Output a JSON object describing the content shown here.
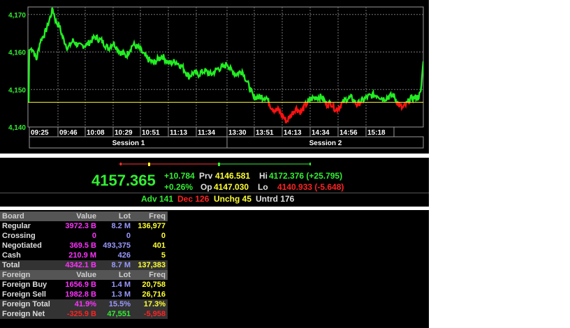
{
  "chart_data": {
    "type": "line",
    "x_ticks": [
      "09:25",
      "09:46",
      "10:08",
      "10:29",
      "10:51",
      "11:13",
      "11:34",
      "13:30",
      "13:51",
      "14:13",
      "14:34",
      "14:56",
      "15:18"
    ],
    "y_ticks": [
      "4,170",
      "4,160",
      "4,150",
      "4,140"
    ],
    "ylim": [
      4140,
      4172
    ],
    "reference_line": 4146.581,
    "sessions": [
      "Session 1",
      "Session 2"
    ],
    "grid": true,
    "colors": {
      "above": "#22ee22",
      "below": "#ff1111",
      "reference": "#ffff33"
    },
    "keypoints": [
      [
        0,
        4146.6
      ],
      [
        1,
        4160.5
      ],
      [
        6,
        4161
      ],
      [
        12,
        4158
      ],
      [
        18,
        4163
      ],
      [
        25,
        4165
      ],
      [
        31,
        4168
      ],
      [
        37,
        4171.5
      ],
      [
        42,
        4168
      ],
      [
        47,
        4167
      ],
      [
        52,
        4164
      ],
      [
        60,
        4161
      ],
      [
        68,
        4163
      ],
      [
        78,
        4161.5
      ],
      [
        90,
        4162
      ],
      [
        102,
        4164
      ],
      [
        112,
        4163
      ],
      [
        122,
        4161
      ],
      [
        130,
        4162.5
      ],
      [
        140,
        4160
      ],
      [
        150,
        4159
      ],
      [
        160,
        4162
      ],
      [
        170,
        4161
      ],
      [
        180,
        4158.5
      ],
      [
        192,
        4157
      ],
      [
        205,
        4159
      ],
      [
        215,
        4157
      ],
      [
        226,
        4157.5
      ],
      [
        236,
        4156
      ],
      [
        246,
        4153.5
      ],
      [
        253,
        4154.5
      ],
      [
        260,
        4154
      ],
      [
        270,
        4155
      ],
      [
        280,
        4154
      ],
      [
        290,
        4155.5
      ],
      [
        300,
        4156
      ],
      [
        305,
        4157
      ],
      [
        310,
        4155.3
      ],
      [
        318,
        4154
      ],
      [
        328,
        4155
      ],
      [
        338,
        4151
      ],
      [
        345,
        4148
      ],
      [
        355,
        4148
      ],
      [
        365,
        4148
      ],
      [
        372,
        4145.5
      ],
      [
        378,
        4144.5
      ],
      [
        384,
        4144.5
      ],
      [
        390,
        4143
      ],
      [
        396,
        4141.5
      ],
      [
        402,
        4143
      ],
      [
        410,
        4145
      ],
      [
        418,
        4144
      ],
      [
        426,
        4146
      ],
      [
        434,
        4147.5
      ],
      [
        442,
        4148
      ],
      [
        450,
        4148
      ],
      [
        458,
        4146
      ],
      [
        464,
        4146.5
      ],
      [
        472,
        4144.5
      ],
      [
        480,
        4146
      ],
      [
        488,
        4147.5
      ],
      [
        496,
        4147.8
      ],
      [
        504,
        4146
      ],
      [
        512,
        4147
      ],
      [
        520,
        4148
      ],
      [
        528,
        4148.5
      ],
      [
        536,
        4148.5
      ],
      [
        544,
        4147.5
      ],
      [
        552,
        4148
      ],
      [
        560,
        4148.5
      ],
      [
        568,
        4146
      ],
      [
        574,
        4145
      ],
      [
        580,
        4146
      ],
      [
        586,
        4147.5
      ],
      [
        592,
        4147.8
      ],
      [
        598,
        4148
      ],
      [
        602,
        4149
      ],
      [
        606,
        4157.5
      ]
    ]
  },
  "summary": {
    "index": "4157.365",
    "change": "+10.784",
    "change_pct": "+0.26%",
    "prv_label": "Prv",
    "prv": "4146.581",
    "op_label": "Op",
    "op": "4147.030",
    "hi_label": "Hi",
    "hi": "4172.376 (+25.795)",
    "lo_label": "Lo",
    "lo": "4140.933 (-5.648)"
  },
  "breadth": {
    "adv": "Adv 141",
    "dec": "Dec 126",
    "unchg": "Unchg 45",
    "untrd": "Untrd 176"
  },
  "board_table": {
    "header1": [
      "Board",
      "Value",
      "Lot",
      "Freq"
    ],
    "rows1": [
      [
        "Regular",
        "3972.3 B",
        "8.2 M",
        "136,977"
      ],
      [
        "Crossing",
        "0",
        "0",
        "0"
      ],
      [
        "Negotiated",
        "369.5 B",
        "493,375",
        "401"
      ],
      [
        "Cash",
        "210.9 M",
        "426",
        "5"
      ]
    ],
    "total": [
      "Total",
      "4342.1 B",
      "8.7 M",
      "137,383"
    ],
    "header2": [
      "Foreign",
      "Value",
      "Lot",
      "Freq"
    ],
    "rows2": [
      [
        "Foreign Buy",
        "1656.9 B",
        "1.4 M",
        "20,758"
      ],
      [
        "Foreign Sell",
        "1982.8 B",
        "1.3 M",
        "26,716"
      ]
    ],
    "foreign_total": [
      "Foreign Total",
      "41.9%",
      "15.5%",
      "17.3%"
    ],
    "foreign_net": [
      "Foreign Net",
      "-325.9 B",
      "47,551",
      "-5,958"
    ]
  }
}
